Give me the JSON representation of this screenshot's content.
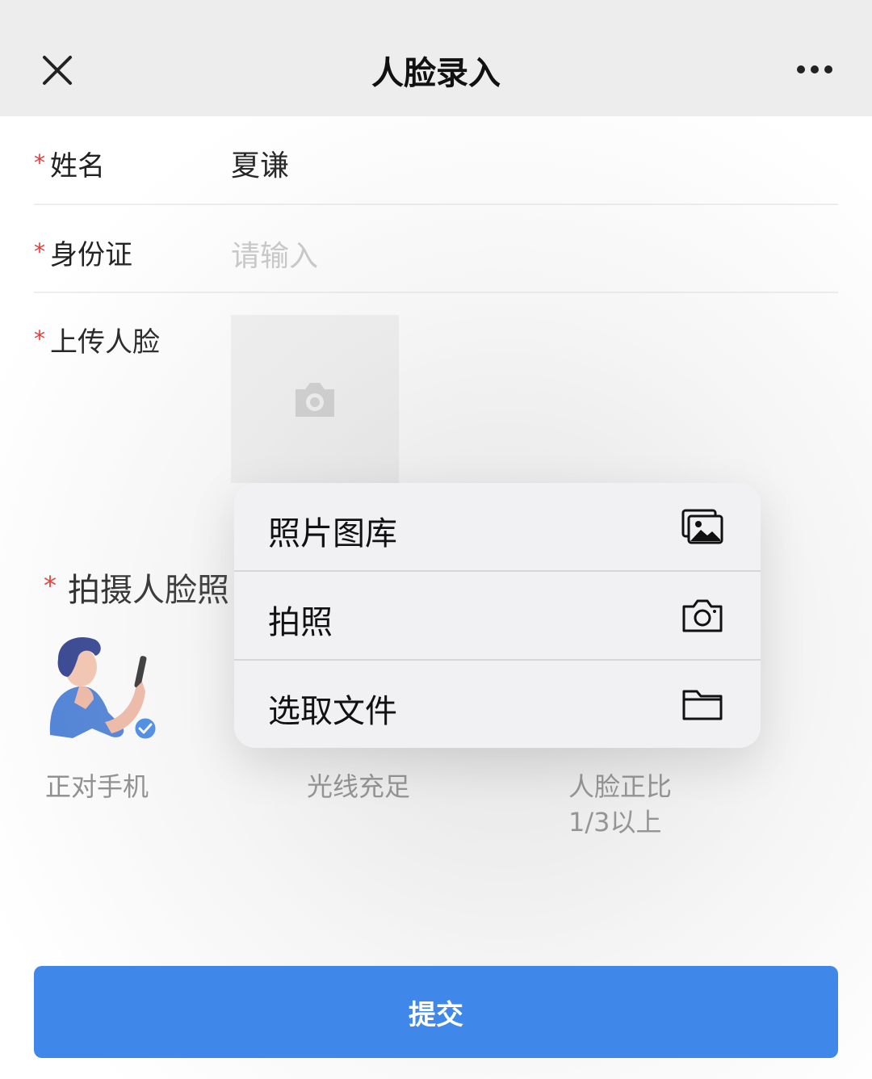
{
  "nav": {
    "title": "人脸录入",
    "close_icon": "close-icon",
    "more_icon": "more-icon"
  },
  "form": {
    "required_mark": "*",
    "name": {
      "label": "姓名",
      "value": "夏谦"
    },
    "id_card": {
      "label": "身份证",
      "placeholder": "请输入"
    },
    "upload": {
      "label": "上传人脸",
      "icon": "camera-icon"
    }
  },
  "capture": {
    "title": "拍摄人脸照",
    "tips": [
      {
        "text": "正对手机"
      },
      {
        "text": "光线充足"
      },
      {
        "text": "人脸正比\n1/3以上"
      }
    ]
  },
  "popup_menu": {
    "items": [
      {
        "label": "照片图库",
        "icon": "photo-library-icon"
      },
      {
        "label": "拍照",
        "icon": "camera-icon"
      },
      {
        "label": "选取文件",
        "icon": "folder-icon"
      }
    ]
  },
  "submit": {
    "label": "提交"
  },
  "colors": {
    "primary": "#3f87e8",
    "required": "#e53935",
    "navbar_bg": "#ededed",
    "menu_bg": "#f1f1f3"
  }
}
